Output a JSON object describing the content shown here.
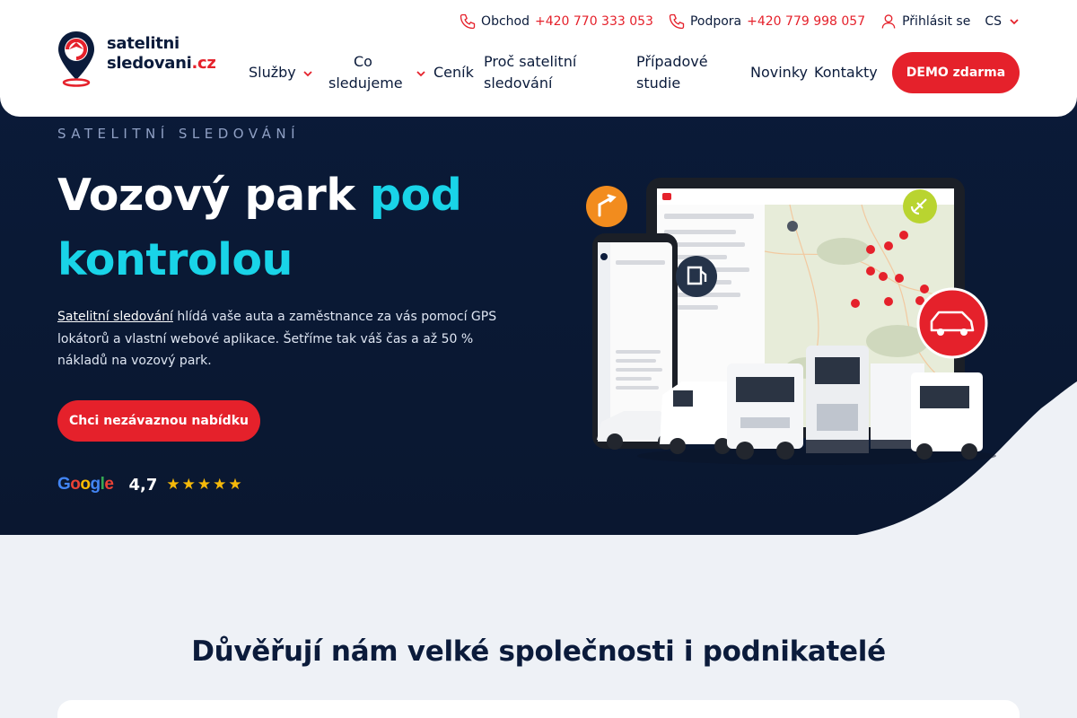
{
  "header": {
    "logo": {
      "line1": "satelitni",
      "line2": "sledovani",
      "tld": ".cz"
    },
    "topbar": {
      "sales_label": "Obchod",
      "sales_phone": "+420 770 333 053",
      "support_label": "Podpora",
      "support_phone": "+420 779 998 057",
      "login_label": "Přihlásit se",
      "language": "CS"
    },
    "nav": {
      "items": [
        {
          "label": "Služby",
          "has_dropdown": true
        },
        {
          "label_line1": "Co",
          "label_line2": "sledujeme",
          "has_dropdown": true
        },
        {
          "label": "Ceník"
        },
        {
          "label_line1": "Proč satelitní",
          "label_line2": "sledování"
        },
        {
          "label_line1": "Případové",
          "label_line2": "studie"
        },
        {
          "label": "Novinky"
        },
        {
          "label": "Kontakty"
        }
      ],
      "demo_button": "DEMO zdarma"
    }
  },
  "hero": {
    "eyebrow": "SATELITNÍ SLEDOVÁNÍ",
    "headline_white": "Vozový park ",
    "headline_accent_1": "pod",
    "headline_accent_2": "kontrolou",
    "lead_link": "Satelitní sledování",
    "lead_text": " hlídá vaše auta a zaměstnance za vás pomocí GPS lokátorů a vlastní webové aplikace. Šetříme tak váš čas a až 50 % nákladů na vozový park.",
    "cta": "Chci nezávaznou nabídku",
    "rating_brand": "Google",
    "rating_value": "4,7",
    "rating_stars": 5
  },
  "trust": {
    "title": "Důvěřují nám velké společnosti i podnikatelé"
  },
  "colors": {
    "brand_red": "#e5212b",
    "navy": "#0b1b3b",
    "accent_cyan": "#19d4e8",
    "hero_bg": "#0b1a3a",
    "page_bg": "#eef1f6",
    "star": "#f5b90a"
  },
  "icons": [
    "logo-pin-icon",
    "phone-icon",
    "user-icon",
    "chevron-down-icon",
    "route-icon",
    "fuel-icon",
    "satellite-icon",
    "car-icon",
    "google-logo"
  ]
}
